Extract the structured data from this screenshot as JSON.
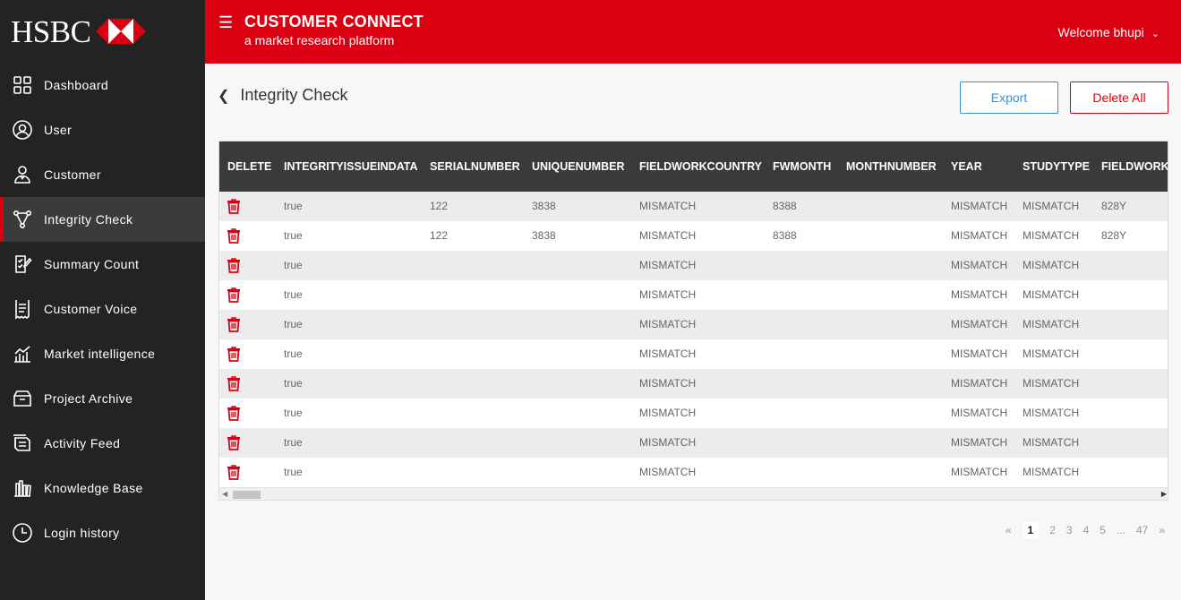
{
  "brand": {
    "logo_text": "HSBC",
    "accent": "#db0011"
  },
  "sidebar": {
    "items": [
      {
        "label": "Dashboard",
        "icon": "dashboard-grid-icon",
        "active": false
      },
      {
        "label": "User",
        "icon": "user-icon",
        "active": false
      },
      {
        "label": "Customer",
        "icon": "customer-icon",
        "active": false
      },
      {
        "label": "Integrity Check",
        "icon": "integrity-nodes-icon",
        "active": true
      },
      {
        "label": "Summary Count",
        "icon": "summary-checklist-icon",
        "active": false
      },
      {
        "label": "Customer Voice",
        "icon": "customer-voice-receipt-icon",
        "active": false
      },
      {
        "label": "Market intelligence",
        "icon": "market-chart-icon",
        "active": false
      },
      {
        "label": "Project Archive",
        "icon": "archive-box-icon",
        "active": false
      },
      {
        "label": "Activity Feed",
        "icon": "activity-feed-icon",
        "active": false
      },
      {
        "label": "Knowledge Base",
        "icon": "knowledge-base-icon",
        "active": false
      },
      {
        "label": "Login history",
        "icon": "clock-icon",
        "active": false
      }
    ]
  },
  "header": {
    "title": "CUSTOMER CONNECT",
    "subtitle": "a market research platform",
    "welcome": "Welcome bhupi"
  },
  "page": {
    "title": "Integrity Check",
    "export_label": "Export",
    "delete_all_label": "Delete All"
  },
  "table": {
    "columns": [
      "DELETE",
      "INTEGRITYISSUEINDATA",
      "SERIALNUMBER",
      "UNIQUENUMBER",
      "FIELDWORKCOUNTRY",
      "FWMONTH",
      "MONTHNUMBER",
      "YEAR",
      "STUDYTYPE",
      "FIELDWORK"
    ],
    "rows": [
      [
        "true",
        "122",
        "3838",
        "MISMATCH",
        "8388",
        "",
        "MISMATCH",
        "MISMATCH",
        "828Y"
      ],
      [
        "true",
        "122",
        "3838",
        "MISMATCH",
        "8388",
        "",
        "MISMATCH",
        "MISMATCH",
        "828Y"
      ],
      [
        "true",
        "",
        "",
        "MISMATCH",
        "",
        "",
        "MISMATCH",
        "MISMATCH",
        ""
      ],
      [
        "true",
        "",
        "",
        "MISMATCH",
        "",
        "",
        "MISMATCH",
        "MISMATCH",
        ""
      ],
      [
        "true",
        "",
        "",
        "MISMATCH",
        "",
        "",
        "MISMATCH",
        "MISMATCH",
        ""
      ],
      [
        "true",
        "",
        "",
        "MISMATCH",
        "",
        "",
        "MISMATCH",
        "MISMATCH",
        ""
      ],
      [
        "true",
        "",
        "",
        "MISMATCH",
        "",
        "",
        "MISMATCH",
        "MISMATCH",
        ""
      ],
      [
        "true",
        "",
        "",
        "MISMATCH",
        "",
        "",
        "MISMATCH",
        "MISMATCH",
        ""
      ],
      [
        "true",
        "",
        "",
        "MISMATCH",
        "",
        "",
        "MISMATCH",
        "MISMATCH",
        ""
      ],
      [
        "true",
        "",
        "",
        "MISMATCH",
        "",
        "",
        "MISMATCH",
        "MISMATCH",
        ""
      ]
    ]
  },
  "pagination": {
    "prev": "«",
    "pages": [
      "1",
      "2",
      "3",
      "4",
      "5",
      "...",
      "47"
    ],
    "current": "1",
    "next": "»"
  }
}
